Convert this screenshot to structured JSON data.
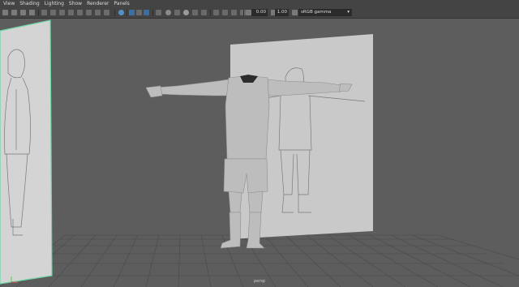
{
  "menubar": {
    "items": [
      "View",
      "Shading",
      "Lighting",
      "Show",
      "Renderer",
      "Panels"
    ]
  },
  "toolbar": {
    "value_a": "0.00",
    "value_b": "1.00",
    "color_space": "sRGB gamma",
    "icons": [
      "camera-select-icon",
      "camera-attr-icon",
      "bookmark-icon",
      "image-plane-icon",
      "grid-icon",
      "film-gate-icon",
      "resolution-gate-icon",
      "gate-mask-icon",
      "field-chart-icon",
      "safe-action-icon",
      "safe-title-icon",
      "wireframe-icon",
      "smooth-shade-icon",
      "use-default-material-icon",
      "wireframe-on-shaded-icon",
      "textured-icon",
      "use-all-lights-icon",
      "shadows-icon",
      "screen-space-ao-icon",
      "motion-blur-icon",
      "multisample-aa-icon",
      "depth-of-field-icon",
      "isolate-select-icon",
      "xray-icon",
      "xray-joints-icon",
      "backface-culling-icon",
      "exposure-icon",
      "gamma-icon",
      "color-management-icon"
    ]
  },
  "viewport": {
    "camera_label": "persp",
    "colors": {
      "background": "#5d5d5d",
      "grid": "#4a4a4a",
      "plane_front": "#c9c9c9",
      "plane_left": "#d4d4d4",
      "plane_edge": "#6fd6a6",
      "model": "#bdbdbd"
    }
  }
}
